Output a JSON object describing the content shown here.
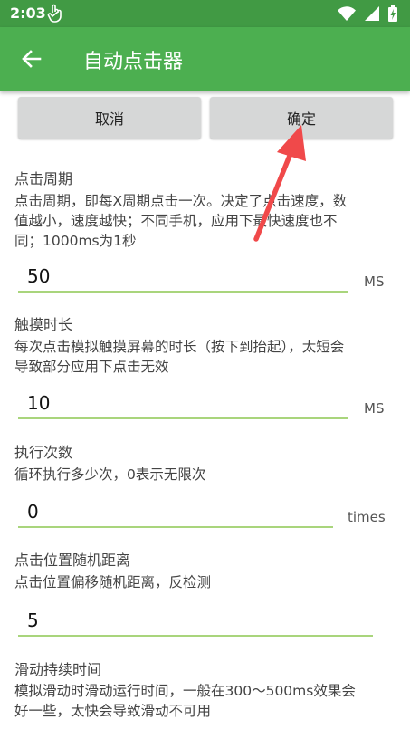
{
  "status_bar": {
    "time": "2:03"
  },
  "app_bar": {
    "title": "自动点击器"
  },
  "buttons": {
    "cancel": "取消",
    "ok": "确定"
  },
  "sections": [
    {
      "title": "点击周期",
      "desc_lines": [
        "点击周期，即每X周期点击一次。决定了点击速度，数",
        "值越小，速度越快；不同手机，应用下最快速度也不",
        "同；1000ms为1秒"
      ],
      "value": "50",
      "unit": "MS"
    },
    {
      "title": "触摸时长",
      "desc_lines": [
        "每次点击模拟触摸屏幕的时长（按下到抬起），太短会",
        "导致部分应用下点击无效"
      ],
      "value": "10",
      "unit": "MS"
    },
    {
      "title": "执行次数",
      "desc_lines": [
        "循环执行多少次，0表示无限次"
      ],
      "value": "0",
      "unit": "times"
    },
    {
      "title": "点击位置随机距离",
      "desc_lines": [
        "点击位置偏移随机距离，反检测"
      ],
      "value": "5",
      "unit": ""
    },
    {
      "title": "滑动持续时间",
      "desc_lines": [
        "模拟滑动时滑动运行时间，一般在300～500ms效果会",
        "好一些，太快会导致滑动不可用"
      ]
    }
  ],
  "colors": {
    "status_bar": "#419a44",
    "app_bar": "#4caf50",
    "field_underline": "#a9d57c",
    "annotation_arrow": "#f0494a"
  }
}
